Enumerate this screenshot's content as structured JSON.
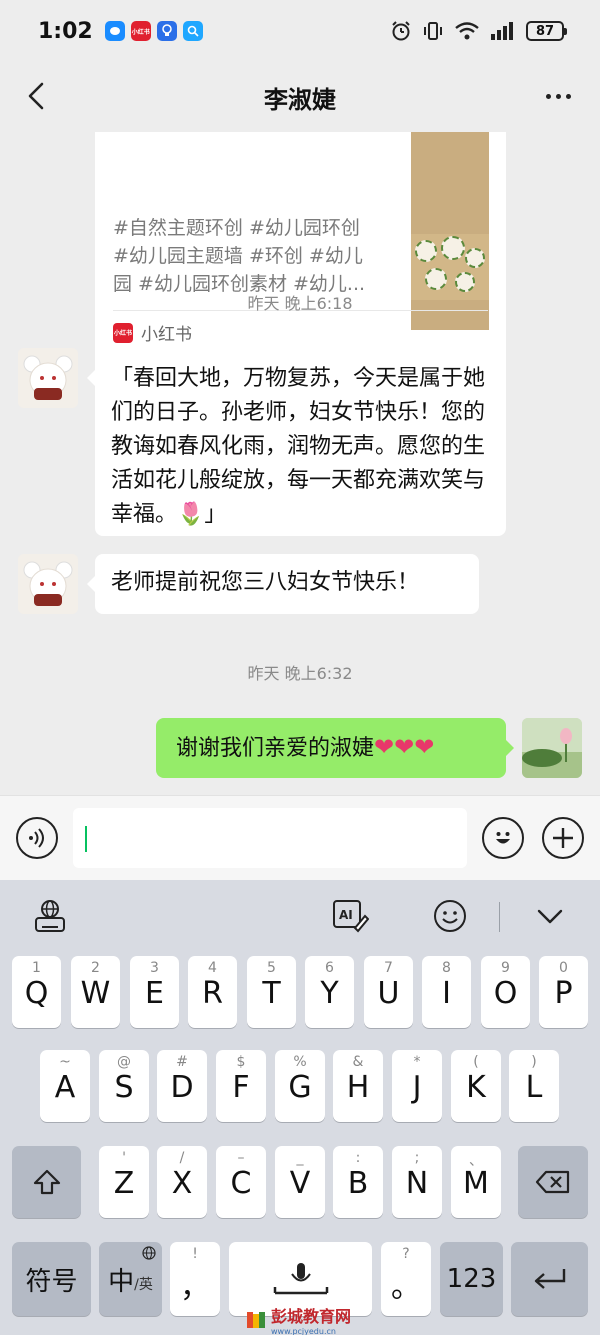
{
  "status_bar": {
    "time": "1:02",
    "battery": "87",
    "apps": [
      {
        "name": "messages-app-icon",
        "label": "",
        "color": "#1a8cff"
      },
      {
        "name": "xiaohongshu-app-icon",
        "label": "小红书",
        "color": "#e0202f"
      },
      {
        "name": "bulb-app-icon",
        "label": "",
        "color": "#2b6fe8"
      },
      {
        "name": "search-app-icon",
        "label": "",
        "color": "#1fa7ff"
      }
    ]
  },
  "header": {
    "title": "李淑婕"
  },
  "card": {
    "tags_line1": "#自然主题环创 #幼儿园环创",
    "tags_line2": "#幼儿园主题墙 #环创 #幼儿",
    "tags_line3": "园 #幼儿园环创素材 #幼儿...",
    "source": "小红书",
    "source_logo": "小红书"
  },
  "messages": {
    "time1": "昨天 晚上6:18",
    "msg1": "「春回大地，万物复苏，今天是属于她们的日子。孙老师，妇女节快乐！您的教诲如春风化雨，润物无声。愿您的生活如花儿般绽放，每一天都充满欢笑与幸福。🌷」",
    "msg2": "老师提前祝您三八妇女节快乐！",
    "time2": "昨天 晚上6:32",
    "msg3": "谢谢我们亲爱的淑婕",
    "msg3_hearts": "❤❤❤"
  },
  "input": {
    "value": ""
  },
  "keyboard": {
    "row1": [
      {
        "hint": "1",
        "key": "Q"
      },
      {
        "hint": "2",
        "key": "W"
      },
      {
        "hint": "3",
        "key": "E"
      },
      {
        "hint": "4",
        "key": "R"
      },
      {
        "hint": "5",
        "key": "T"
      },
      {
        "hint": "6",
        "key": "Y"
      },
      {
        "hint": "7",
        "key": "U"
      },
      {
        "hint": "8",
        "key": "I"
      },
      {
        "hint": "9",
        "key": "O"
      },
      {
        "hint": "0",
        "key": "P"
      }
    ],
    "row2": [
      {
        "hint": "~",
        "key": "A"
      },
      {
        "hint": "@",
        "key": "S"
      },
      {
        "hint": "#",
        "key": "D"
      },
      {
        "hint": "$",
        "key": "F"
      },
      {
        "hint": "%",
        "key": "G"
      },
      {
        "hint": "&",
        "key": "H"
      },
      {
        "hint": "*",
        "key": "J"
      },
      {
        "hint": "(",
        "key": "K"
      },
      {
        "hint": ")",
        "key": "L"
      }
    ],
    "row3": [
      {
        "hint": "'",
        "key": "Z"
      },
      {
        "hint": "/",
        "key": "X"
      },
      {
        "hint": "–",
        "key": "C"
      },
      {
        "hint": "_",
        "key": "V"
      },
      {
        "hint": ":",
        "key": "B"
      },
      {
        "hint": ";",
        "key": "N"
      },
      {
        "hint": "、",
        "key": "M"
      }
    ],
    "symbols_label": "符号",
    "lang_label": "中",
    "lang_sub": "/英",
    "comma_hint": "!",
    "comma": "，",
    "period_hint": "?",
    "period": "。",
    "numbers_label": "123"
  },
  "watermark": {
    "text": "彭城教育网",
    "sub": "www.pcjyedu.cn"
  }
}
